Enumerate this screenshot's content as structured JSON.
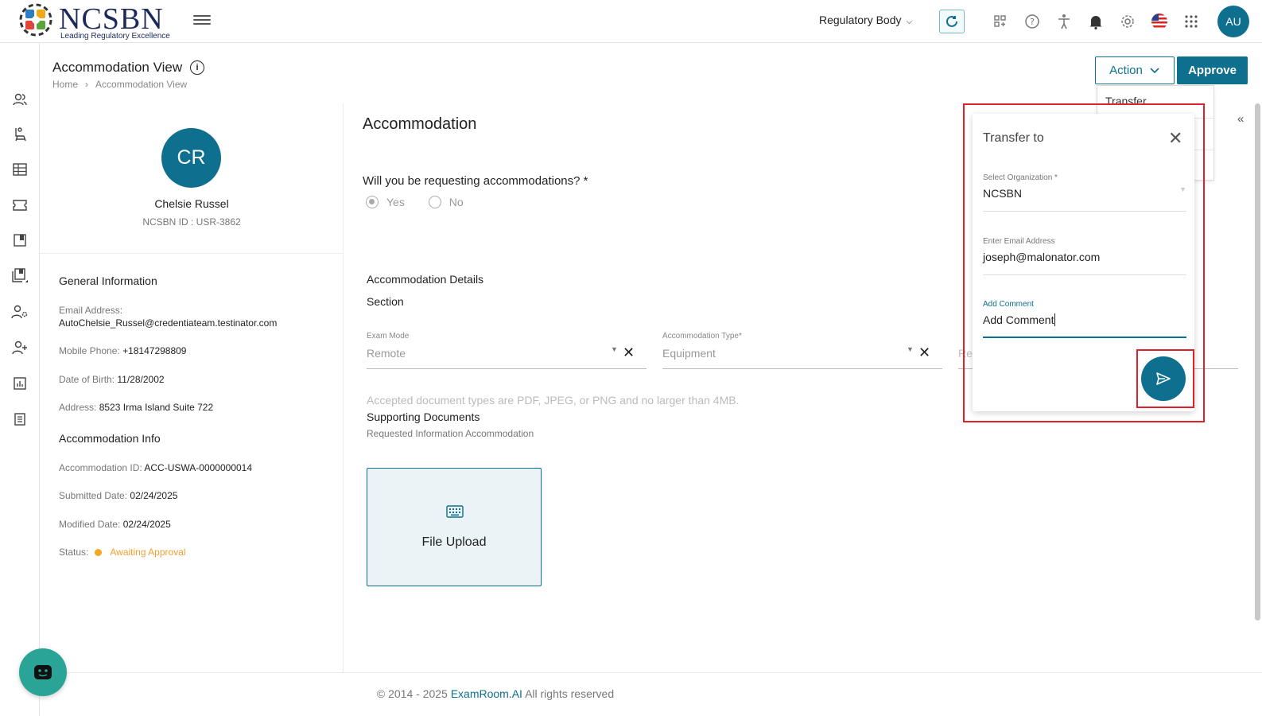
{
  "header": {
    "logo_text": "NCSBN",
    "logo_tagline": "Leading Regulatory Excellence",
    "regulatory_body": "Regulatory Body",
    "user_initials": "AU"
  },
  "rail": {
    "icons": [
      "users-icon",
      "chair-icon",
      "table-icon",
      "ticket-icon",
      "book-icon",
      "library-icon",
      "user-settings-icon",
      "person-add-icon",
      "report-icon",
      "document-icon"
    ]
  },
  "page": {
    "title": "Accommodation View",
    "breadcrumb": [
      "Home",
      "Accommodation View"
    ],
    "action_label": "Action",
    "approve_label": "Approve",
    "action_menu": [
      "Transfer"
    ]
  },
  "profile": {
    "initials": "CR",
    "name": "Chelsie Russel",
    "id_line": "NCSBN ID : USR-3862",
    "general_heading": "General Information",
    "email_label": "Email Address:",
    "email": "AutoChelsie_Russel@credentiateam.testinator.com",
    "phone_label": "Mobile Phone:",
    "phone": "+18147298809",
    "dob_label": "Date of Birth:",
    "dob": "11/28/2002",
    "address_label": "Address:",
    "address": "8523 Irma Island Suite 722",
    "accom_heading": "Accommodation Info",
    "accom_id_label": "Accommodation ID:",
    "accom_id": "ACC-USWA-0000000014",
    "submitted_label": "Submitted Date:",
    "submitted": "02/24/2025",
    "modified_label": "Modified Date:",
    "modified": "02/24/2025",
    "status_label": "Status:",
    "status": "Awaiting Approval",
    "status_color": "#f5a623"
  },
  "form": {
    "title": "Accommodation",
    "question": "Will you be requesting accommodations? *",
    "yes_label": "Yes",
    "no_label": "No",
    "selected": "Yes",
    "details_heading": "Accommodation Details",
    "section_label": "Section",
    "exam_mode_label": "Exam Mode",
    "exam_mode_value": "Remote",
    "accom_type_label": "Accommodation Type*",
    "accom_type_value": "Equipment",
    "reason_value": "Rea",
    "accepted_text": "Accepted document types are PDF, JPEG, or PNG and no larger than 4MB.",
    "supporting_label": "Supporting Documents",
    "requested_label": "Requested Information Accommodation",
    "upload_label": "File Upload"
  },
  "transfer": {
    "title": "Transfer to",
    "org_label": "Select Organization *",
    "org_value": "NCSBN",
    "email_label": "Enter Email Address",
    "email_value": "joseph@malonator.com",
    "comment_label": "Add Comment",
    "comment_value": "Add Comment"
  },
  "footer": {
    "prefix": "© 2014 - 2025 ",
    "brand": "ExamRoom.AI",
    "suffix": " All rights reserved"
  },
  "colors": {
    "primary": "#0e6f8e",
    "highlight": "#e0202a",
    "chat": "#2aa497"
  }
}
